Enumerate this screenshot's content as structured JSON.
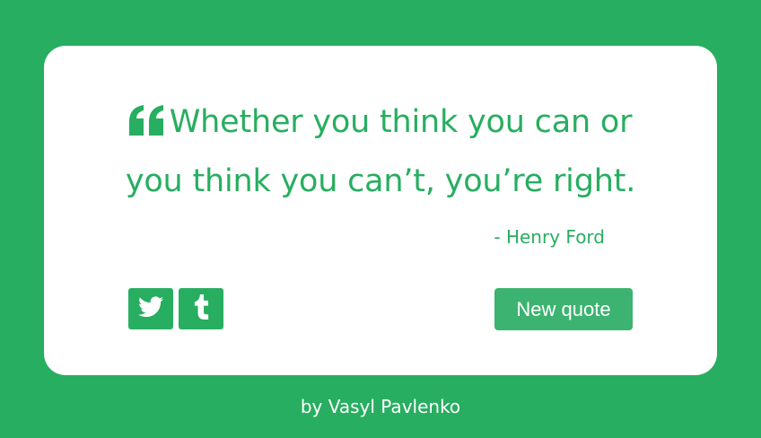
{
  "quote": {
    "text": "Whether you think you can or you think you can’t, you’re right.",
    "author": "- Henry Ford"
  },
  "actions": {
    "twitter_icon": "twitter-icon",
    "tumblr_icon": "tumblr-icon",
    "new_quote_label": "New quote"
  },
  "footer": {
    "credit": "by Vasyl Pavlenko"
  },
  "colors": {
    "background": "#27ae60",
    "card": "#ffffff",
    "accent": "#27ae60",
    "button": "#3cb371"
  }
}
